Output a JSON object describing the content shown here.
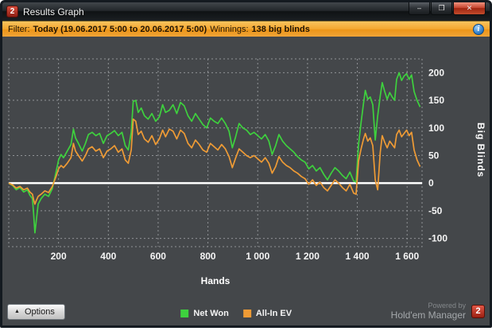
{
  "window": {
    "title": "Results Graph",
    "app_icon_text": "2",
    "controls": [
      {
        "name": "minimize",
        "glyph": "–"
      },
      {
        "name": "maximize",
        "glyph": "❐"
      },
      {
        "name": "close",
        "glyph": "✕"
      }
    ]
  },
  "filter_bar": {
    "label": "Filter:",
    "value": "Today (19.06.2017 5:00 to 20.06.2017 5:00)",
    "winnings_label": "Winnings:",
    "winnings_value": "138 big blinds",
    "info_glyph": "i"
  },
  "chart_data": {
    "type": "line",
    "xlabel": "Hands",
    "ylabel": "Big Blinds",
    "xlim": [
      0,
      1660
    ],
    "ylim": [
      -115,
      225
    ],
    "xticks": [
      200,
      400,
      600,
      800,
      1000,
      1200,
      1400,
      1600
    ],
    "xtick_labels": [
      "200",
      "400",
      "600",
      "800",
      "1 000",
      "1 200",
      "1 400",
      "1 600"
    ],
    "yticks": [
      200,
      150,
      100,
      50,
      0,
      -50,
      -100
    ],
    "grid": "dashed",
    "grid_color": "#909396",
    "tick_color": "#f5f5f5",
    "zero_line": true,
    "zero_line_color": "#ffffff",
    "legend_position": "bottom",
    "series": [
      {
        "name": "Net Won",
        "color": "#3ed13e",
        "points": [
          [
            0,
            0
          ],
          [
            15,
            -4
          ],
          [
            30,
            -12
          ],
          [
            45,
            -8
          ],
          [
            60,
            -16
          ],
          [
            75,
            -12
          ],
          [
            85,
            -22
          ],
          [
            95,
            -28
          ],
          [
            100,
            -55
          ],
          [
            105,
            -90
          ],
          [
            110,
            -70
          ],
          [
            118,
            -38
          ],
          [
            130,
            -28
          ],
          [
            145,
            -20
          ],
          [
            160,
            -24
          ],
          [
            175,
            -10
          ],
          [
            190,
            20
          ],
          [
            200,
            42
          ],
          [
            210,
            52
          ],
          [
            220,
            46
          ],
          [
            235,
            58
          ],
          [
            250,
            70
          ],
          [
            260,
            98
          ],
          [
            268,
            82
          ],
          [
            280,
            72
          ],
          [
            295,
            58
          ],
          [
            308,
            72
          ],
          [
            320,
            88
          ],
          [
            335,
            92
          ],
          [
            350,
            86
          ],
          [
            365,
            90
          ],
          [
            380,
            72
          ],
          [
            395,
            86
          ],
          [
            410,
            90
          ],
          [
            425,
            95
          ],
          [
            440,
            86
          ],
          [
            455,
            92
          ],
          [
            468,
            68
          ],
          [
            480,
            60
          ],
          [
            492,
            92
          ],
          [
            500,
            148
          ],
          [
            510,
            150
          ],
          [
            520,
            128
          ],
          [
            532,
            136
          ],
          [
            545,
            122
          ],
          [
            560,
            116
          ],
          [
            575,
            126
          ],
          [
            590,
            112
          ],
          [
            605,
            120
          ],
          [
            618,
            142
          ],
          [
            630,
            128
          ],
          [
            645,
            132
          ],
          [
            660,
            142
          ],
          [
            675,
            126
          ],
          [
            690,
            146
          ],
          [
            705,
            140
          ],
          [
            720,
            122
          ],
          [
            735,
            112
          ],
          [
            750,
            126
          ],
          [
            765,
            116
          ],
          [
            780,
            106
          ],
          [
            795,
            100
          ],
          [
            810,
            118
          ],
          [
            825,
            112
          ],
          [
            840,
            108
          ],
          [
            855,
            118
          ],
          [
            870,
            108
          ],
          [
            885,
            94
          ],
          [
            898,
            64
          ],
          [
            910,
            82
          ],
          [
            925,
            108
          ],
          [
            940,
            100
          ],
          [
            955,
            96
          ],
          [
            970,
            88
          ],
          [
            985,
            92
          ],
          [
            1000,
            86
          ],
          [
            1015,
            80
          ],
          [
            1030,
            88
          ],
          [
            1045,
            76
          ],
          [
            1058,
            52
          ],
          [
            1072,
            68
          ],
          [
            1085,
            88
          ],
          [
            1100,
            76
          ],
          [
            1115,
            68
          ],
          [
            1130,
            62
          ],
          [
            1145,
            56
          ],
          [
            1160,
            48
          ],
          [
            1175,
            42
          ],
          [
            1190,
            38
          ],
          [
            1205,
            26
          ],
          [
            1220,
            32
          ],
          [
            1235,
            22
          ],
          [
            1250,
            28
          ],
          [
            1265,
            16
          ],
          [
            1280,
            6
          ],
          [
            1295,
            18
          ],
          [
            1310,
            28
          ],
          [
            1325,
            22
          ],
          [
            1340,
            14
          ],
          [
            1355,
            8
          ],
          [
            1370,
            20
          ],
          [
            1385,
            4
          ],
          [
            1395,
            2
          ],
          [
            1405,
            70
          ],
          [
            1415,
            110
          ],
          [
            1425,
            145
          ],
          [
            1432,
            168
          ],
          [
            1442,
            152
          ],
          [
            1452,
            156
          ],
          [
            1462,
            142
          ],
          [
            1472,
            78
          ],
          [
            1482,
            122
          ],
          [
            1492,
            158
          ],
          [
            1500,
            182
          ],
          [
            1510,
            166
          ],
          [
            1520,
            152
          ],
          [
            1530,
            164
          ],
          [
            1540,
            156
          ],
          [
            1550,
            150
          ],
          [
            1558,
            188
          ],
          [
            1568,
            200
          ],
          [
            1578,
            186
          ],
          [
            1588,
            194
          ],
          [
            1598,
            198
          ],
          [
            1608,
            188
          ],
          [
            1618,
            196
          ],
          [
            1628,
            166
          ],
          [
            1640,
            150
          ],
          [
            1652,
            138
          ]
        ]
      },
      {
        "name": "All-In EV",
        "color": "#ef9b35",
        "points": [
          [
            0,
            0
          ],
          [
            15,
            -3
          ],
          [
            30,
            -9
          ],
          [
            45,
            -6
          ],
          [
            60,
            -12
          ],
          [
            75,
            -9
          ],
          [
            85,
            -16
          ],
          [
            95,
            -20
          ],
          [
            100,
            -30
          ],
          [
            105,
            -38
          ],
          [
            110,
            -32
          ],
          [
            118,
            -24
          ],
          [
            130,
            -20
          ],
          [
            145,
            -14
          ],
          [
            160,
            -17
          ],
          [
            175,
            -6
          ],
          [
            190,
            12
          ],
          [
            200,
            26
          ],
          [
            210,
            32
          ],
          [
            220,
            28
          ],
          [
            235,
            36
          ],
          [
            250,
            46
          ],
          [
            260,
            72
          ],
          [
            268,
            58
          ],
          [
            280,
            50
          ],
          [
            295,
            40
          ],
          [
            308,
            50
          ],
          [
            320,
            62
          ],
          [
            335,
            66
          ],
          [
            350,
            58
          ],
          [
            365,
            62
          ],
          [
            380,
            46
          ],
          [
            395,
            58
          ],
          [
            410,
            62
          ],
          [
            425,
            68
          ],
          [
            440,
            56
          ],
          [
            455,
            62
          ],
          [
            468,
            42
          ],
          [
            480,
            36
          ],
          [
            492,
            60
          ],
          [
            500,
            116
          ],
          [
            510,
            112
          ],
          [
            520,
            88
          ],
          [
            532,
            94
          ],
          [
            545,
            80
          ],
          [
            560,
            74
          ],
          [
            575,
            86
          ],
          [
            590,
            70
          ],
          [
            605,
            80
          ],
          [
            618,
            96
          ],
          [
            630,
            84
          ],
          [
            645,
            98
          ],
          [
            660,
            94
          ],
          [
            675,
            80
          ],
          [
            690,
            96
          ],
          [
            705,
            90
          ],
          [
            720,
            72
          ],
          [
            735,
            64
          ],
          [
            750,
            78
          ],
          [
            765,
            70
          ],
          [
            780,
            60
          ],
          [
            795,
            56
          ],
          [
            810,
            72
          ],
          [
            825,
            66
          ],
          [
            840,
            60
          ],
          [
            855,
            70
          ],
          [
            870,
            62
          ],
          [
            885,
            48
          ],
          [
            898,
            28
          ],
          [
            910,
            44
          ],
          [
            925,
            62
          ],
          [
            940,
            56
          ],
          [
            955,
            50
          ],
          [
            970,
            46
          ],
          [
            985,
            50
          ],
          [
            1000,
            44
          ],
          [
            1015,
            38
          ],
          [
            1030,
            46
          ],
          [
            1045,
            36
          ],
          [
            1058,
            18
          ],
          [
            1072,
            30
          ],
          [
            1085,
            48
          ],
          [
            1100,
            38
          ],
          [
            1115,
            32
          ],
          [
            1130,
            28
          ],
          [
            1145,
            22
          ],
          [
            1160,
            18
          ],
          [
            1175,
            12
          ],
          [
            1190,
            8
          ],
          [
            1205,
            -2
          ],
          [
            1220,
            6
          ],
          [
            1235,
            -4
          ],
          [
            1250,
            2
          ],
          [
            1265,
            -8
          ],
          [
            1280,
            -14
          ],
          [
            1295,
            -4
          ],
          [
            1310,
            6
          ],
          [
            1325,
            0
          ],
          [
            1340,
            -8
          ],
          [
            1355,
            -14
          ],
          [
            1370,
            -2
          ],
          [
            1385,
            -18
          ],
          [
            1395,
            -20
          ],
          [
            1405,
            40
          ],
          [
            1415,
            62
          ],
          [
            1425,
            80
          ],
          [
            1432,
            90
          ],
          [
            1442,
            76
          ],
          [
            1452,
            82
          ],
          [
            1462,
            68
          ],
          [
            1472,
            6
          ],
          [
            1482,
            -12
          ],
          [
            1492,
            56
          ],
          [
            1500,
            86
          ],
          [
            1510,
            74
          ],
          [
            1520,
            64
          ],
          [
            1530,
            76
          ],
          [
            1540,
            70
          ],
          [
            1550,
            64
          ],
          [
            1558,
            88
          ],
          [
            1568,
            96
          ],
          [
            1578,
            84
          ],
          [
            1588,
            90
          ],
          [
            1598,
            96
          ],
          [
            1608,
            86
          ],
          [
            1618,
            92
          ],
          [
            1628,
            60
          ],
          [
            1640,
            42
          ],
          [
            1652,
            30
          ]
        ]
      }
    ]
  },
  "footer": {
    "options_label": "Options",
    "powered_by": "Powered by",
    "brand": "Hold'em Manager",
    "brand_badge": "2"
  },
  "colors": {
    "filter_bar_orange": "#f2a52e",
    "brand_red": "#b5291c",
    "chart_background": "#44474a"
  }
}
